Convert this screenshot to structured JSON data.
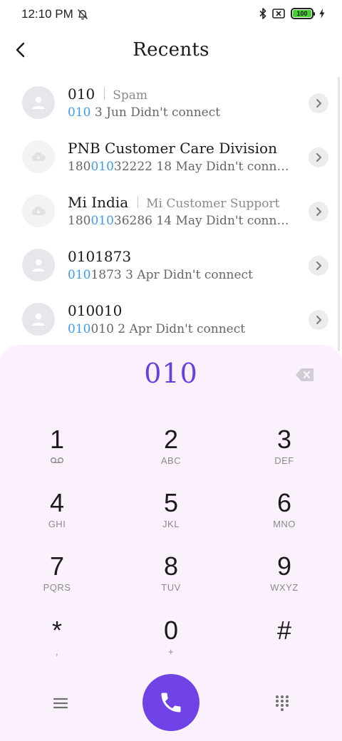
{
  "status_bar": {
    "time": "12:10 PM",
    "icons": [
      "alarm-off-icon",
      "bluetooth-icon",
      "sim-off-icon",
      "battery-icon",
      "charging-icon"
    ],
    "battery_level": "100",
    "battery_color": "#43d12d"
  },
  "header": {
    "title": "Recents",
    "back_icon": "back-arrow-icon"
  },
  "recents": [
    {
      "name": "010",
      "tag": "Spam",
      "number_pre": "",
      "number_match": "010",
      "number_post": "",
      "detail": " 3 Jun Didn't connect",
      "avatar": "person-icon"
    },
    {
      "name": "PNB Customer Care Division",
      "tag": "",
      "number_pre": "180",
      "number_match": "010",
      "number_post": "32222",
      "detail": " 18 May Didn't connect",
      "avatar": "cloud-icon"
    },
    {
      "name": "Mi India",
      "tag": "Mi Customer Support",
      "number_pre": "180",
      "number_match": "010",
      "number_post": "36286",
      "detail": " 14 May Didn't connect",
      "avatar": "cloud-icon"
    },
    {
      "name": "0101873",
      "tag": "",
      "number_pre": "",
      "number_match": "010",
      "number_post": "1873",
      "detail": " 3 Apr Didn't connect",
      "avatar": "person-icon"
    },
    {
      "name": "010010",
      "tag": "",
      "number_pre": "",
      "number_match": "010",
      "number_post": "010",
      "detail": " 2 Apr Didn't connect",
      "avatar": "person-icon"
    }
  ],
  "dialer": {
    "number": "010",
    "accent_color": "#6a3fe0",
    "keys": [
      {
        "digit": "1",
        "sub": ""
      },
      {
        "digit": "2",
        "sub": "ABC"
      },
      {
        "digit": "3",
        "sub": "DEF"
      },
      {
        "digit": "4",
        "sub": "GHI"
      },
      {
        "digit": "5",
        "sub": "JKL"
      },
      {
        "digit": "6",
        "sub": "MNO"
      },
      {
        "digit": "7",
        "sub": "PQRS"
      },
      {
        "digit": "8",
        "sub": "TUV"
      },
      {
        "digit": "9",
        "sub": "WXYZ"
      },
      {
        "digit": "*",
        "sub": ","
      },
      {
        "digit": "0",
        "sub": "+"
      },
      {
        "digit": "#",
        "sub": ""
      }
    ],
    "bottom_icons": [
      "menu-icon",
      "phone-icon",
      "keypad-icon"
    ],
    "call_color": "#7043e6"
  }
}
